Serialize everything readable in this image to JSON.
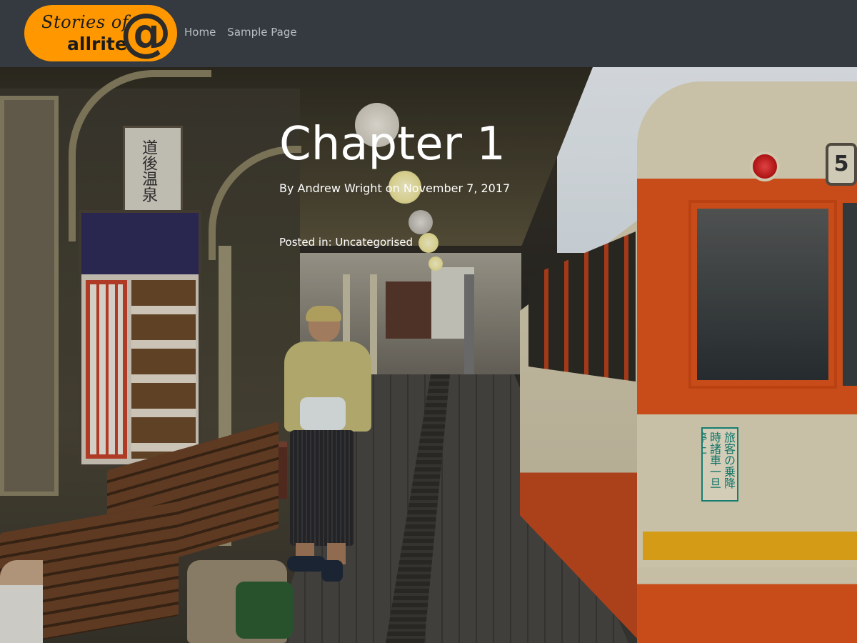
{
  "site": {
    "logo_line1": "Stories of",
    "logo_line2": "allrite",
    "logo_at": "@",
    "logo_color": "#ff9800",
    "navbar_color": "#343a40"
  },
  "nav": {
    "items": [
      {
        "label": "Home"
      },
      {
        "label": "Sample Page"
      }
    ]
  },
  "post": {
    "title": "Chapter 1",
    "by_prefix": "By ",
    "author": "Andrew Wright",
    "on_text": " on ",
    "date": "November 7, 2017",
    "posted_in_label": "Posted in: ",
    "category": "Uncategorised"
  },
  "hero_image": {
    "station_sign_text": "道後温泉",
    "tram_number": "5",
    "tram_notice_text": "旅客の乗降時諸車一旦停止"
  }
}
